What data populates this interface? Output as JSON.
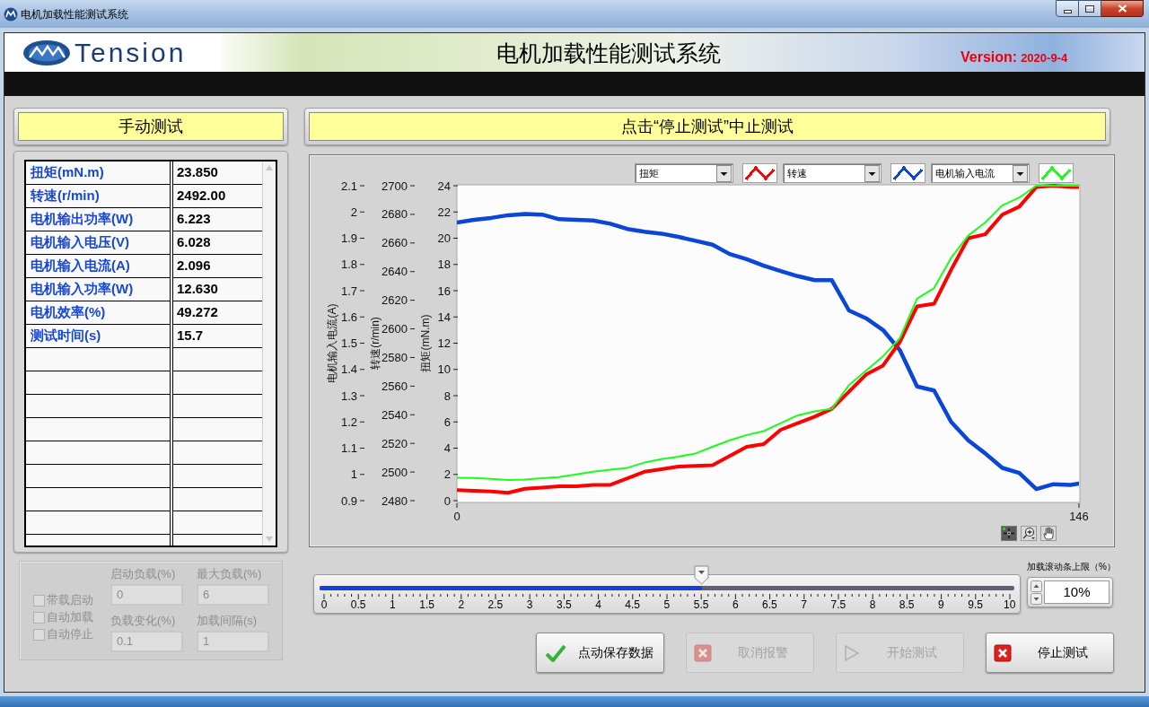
{
  "window": {
    "title": "电机加载性能测试系统"
  },
  "banner": {
    "logo": "Tension",
    "title": "电机加载性能测试系统",
    "version_label": "Version:",
    "version": "2020-9-4"
  },
  "manual_panel": {
    "title": "手动测试",
    "rows": [
      {
        "label": "扭矩(mN.m)",
        "value": "23.850"
      },
      {
        "label": "转速(r/min)",
        "value": "2492.00"
      },
      {
        "label": "电机输出功率(W)",
        "value": "6.223"
      },
      {
        "label": "电机输入电压(V)",
        "value": "6.028"
      },
      {
        "label": "电机输入电流(A)",
        "value": "2.096"
      },
      {
        "label": "电机输入功率(W)",
        "value": "12.630"
      },
      {
        "label": "电机效率(%)",
        "value": "49.272"
      },
      {
        "label": "测试时间(s)",
        "value": "15.7"
      }
    ]
  },
  "load_settings": {
    "checkboxes": [
      {
        "label": "带载启动",
        "checked": false,
        "disabled": true
      },
      {
        "label": "自动加载",
        "checked": false,
        "disabled": true
      },
      {
        "label": "自动停止",
        "checked": false,
        "disabled": true
      }
    ],
    "fields": [
      {
        "label": "启动负载(%)",
        "value": "0",
        "disabled": true
      },
      {
        "label": "最大负载(%)",
        "value": "6",
        "disabled": true
      },
      {
        "label": "负载变化(%)",
        "value": "0.1",
        "disabled": true
      },
      {
        "label": "加载间隔(s)",
        "value": "1",
        "disabled": true
      }
    ]
  },
  "chart_panel": {
    "title": "点击“停止测试”中止测试",
    "chart_data": {
      "type": "line",
      "x": [
        0,
        4,
        8,
        12,
        16,
        20,
        24,
        28,
        32,
        36,
        40,
        44,
        48,
        52,
        56,
        60,
        64,
        68,
        72,
        76,
        80,
        84,
        88,
        92,
        96,
        100,
        104,
        108,
        112,
        116,
        120,
        124,
        128,
        132,
        136,
        140,
        144,
        146
      ],
      "xlim": [
        0,
        146
      ],
      "xticks": [
        0,
        146
      ],
      "ylabel": "扭矩(mN.m)",
      "ylim": [
        0,
        24
      ],
      "yticks": [
        0,
        2,
        4,
        6,
        8,
        10,
        12,
        14,
        16,
        18,
        20,
        22,
        24
      ],
      "y2label": "转速(r/min)",
      "y2lim": [
        2480,
        2700
      ],
      "y2ticks": [
        2480,
        2500,
        2520,
        2540,
        2560,
        2580,
        2600,
        2620,
        2640,
        2660,
        2680,
        2700
      ],
      "y3label": "电机输入电流(A)",
      "y3lim": [
        0.9,
        2.1
      ],
      "y3ticks": [
        0.9,
        1,
        1.1,
        1.2,
        1.3,
        1.4,
        1.5,
        1.6,
        1.7,
        1.8,
        1.9,
        2,
        2.1
      ],
      "series": [
        {
          "name": "扭矩",
          "color": "#ff0000",
          "values": [
            0.8,
            0.75,
            0.7,
            0.6,
            0.9,
            1.0,
            1.1,
            1.1,
            1.2,
            1.2,
            1.7,
            2.2,
            2.4,
            2.6,
            2.65,
            2.7,
            3.4,
            4.1,
            4.3,
            5.4,
            5.9,
            6.4,
            7.0,
            8.3,
            9.6,
            10.3,
            12.1,
            14.8,
            15.0,
            17.6,
            20.0,
            20.3,
            21.8,
            22.4,
            23.9,
            24.0,
            23.9,
            23.9
          ]
        },
        {
          "name": "转速",
          "color": "#0a46d8",
          "axis": "y2",
          "values": [
            2674.3,
            2676.2,
            2677.5,
            2679.4,
            2680.3,
            2679.8,
            2676.6,
            2676.2,
            2675.7,
            2673.4,
            2669.8,
            2667.9,
            2666.5,
            2664.3,
            2661.5,
            2658.8,
            2652.3,
            2648.7,
            2644.1,
            2640.4,
            2636.8,
            2634.0,
            2634.0,
            2612.9,
            2607.4,
            2599.2,
            2585.0,
            2559.8,
            2557.0,
            2535.0,
            2522.2,
            2513.0,
            2502.9,
            2499.3,
            2488.1,
            2491.5,
            2491.0,
            2491.9
          ]
        },
        {
          "name": "电机输入电流",
          "color": "#1aff1a",
          "axis": "y3",
          "values": [
            0.987,
            0.986,
            0.983,
            0.979,
            0.98,
            0.985,
            0.99,
            1.0,
            1.01,
            1.018,
            1.025,
            1.045,
            1.058,
            1.068,
            1.08,
            1.105,
            1.13,
            1.15,
            1.165,
            1.195,
            1.225,
            1.24,
            1.25,
            1.34,
            1.395,
            1.45,
            1.52,
            1.67,
            1.71,
            1.825,
            1.91,
            1.96,
            2.025,
            2.055,
            2.1,
            2.1,
            2.1,
            2.1
          ]
        }
      ]
    },
    "tools": [
      {
        "kind": "cursor",
        "selected": true
      },
      {
        "kind": "zoom",
        "selected": false
      },
      {
        "kind": "pan",
        "selected": false
      }
    ]
  },
  "load_slider": {
    "ticks": [
      "0",
      "0.5",
      "1",
      "1.5",
      "2",
      "2.5",
      "3",
      "3.5",
      "4",
      "4.5",
      "5",
      "5.5",
      "6",
      "6.5",
      "7",
      "7.5",
      "8",
      "8.5",
      "9",
      "9.5",
      "10"
    ],
    "level": 0.55
  },
  "slider_limit": {
    "label": "加载滚动条上限（%）",
    "value": "10%"
  },
  "buttons": [
    {
      "label": "点动保存数据",
      "kind": "check",
      "disabled": false
    },
    {
      "label": "取消报警",
      "kind": "cancel",
      "disabled": true
    },
    {
      "label": "开始测试",
      "kind": "play",
      "disabled": true
    },
    {
      "label": "停止测试",
      "kind": "stop",
      "disabled": false
    }
  ]
}
